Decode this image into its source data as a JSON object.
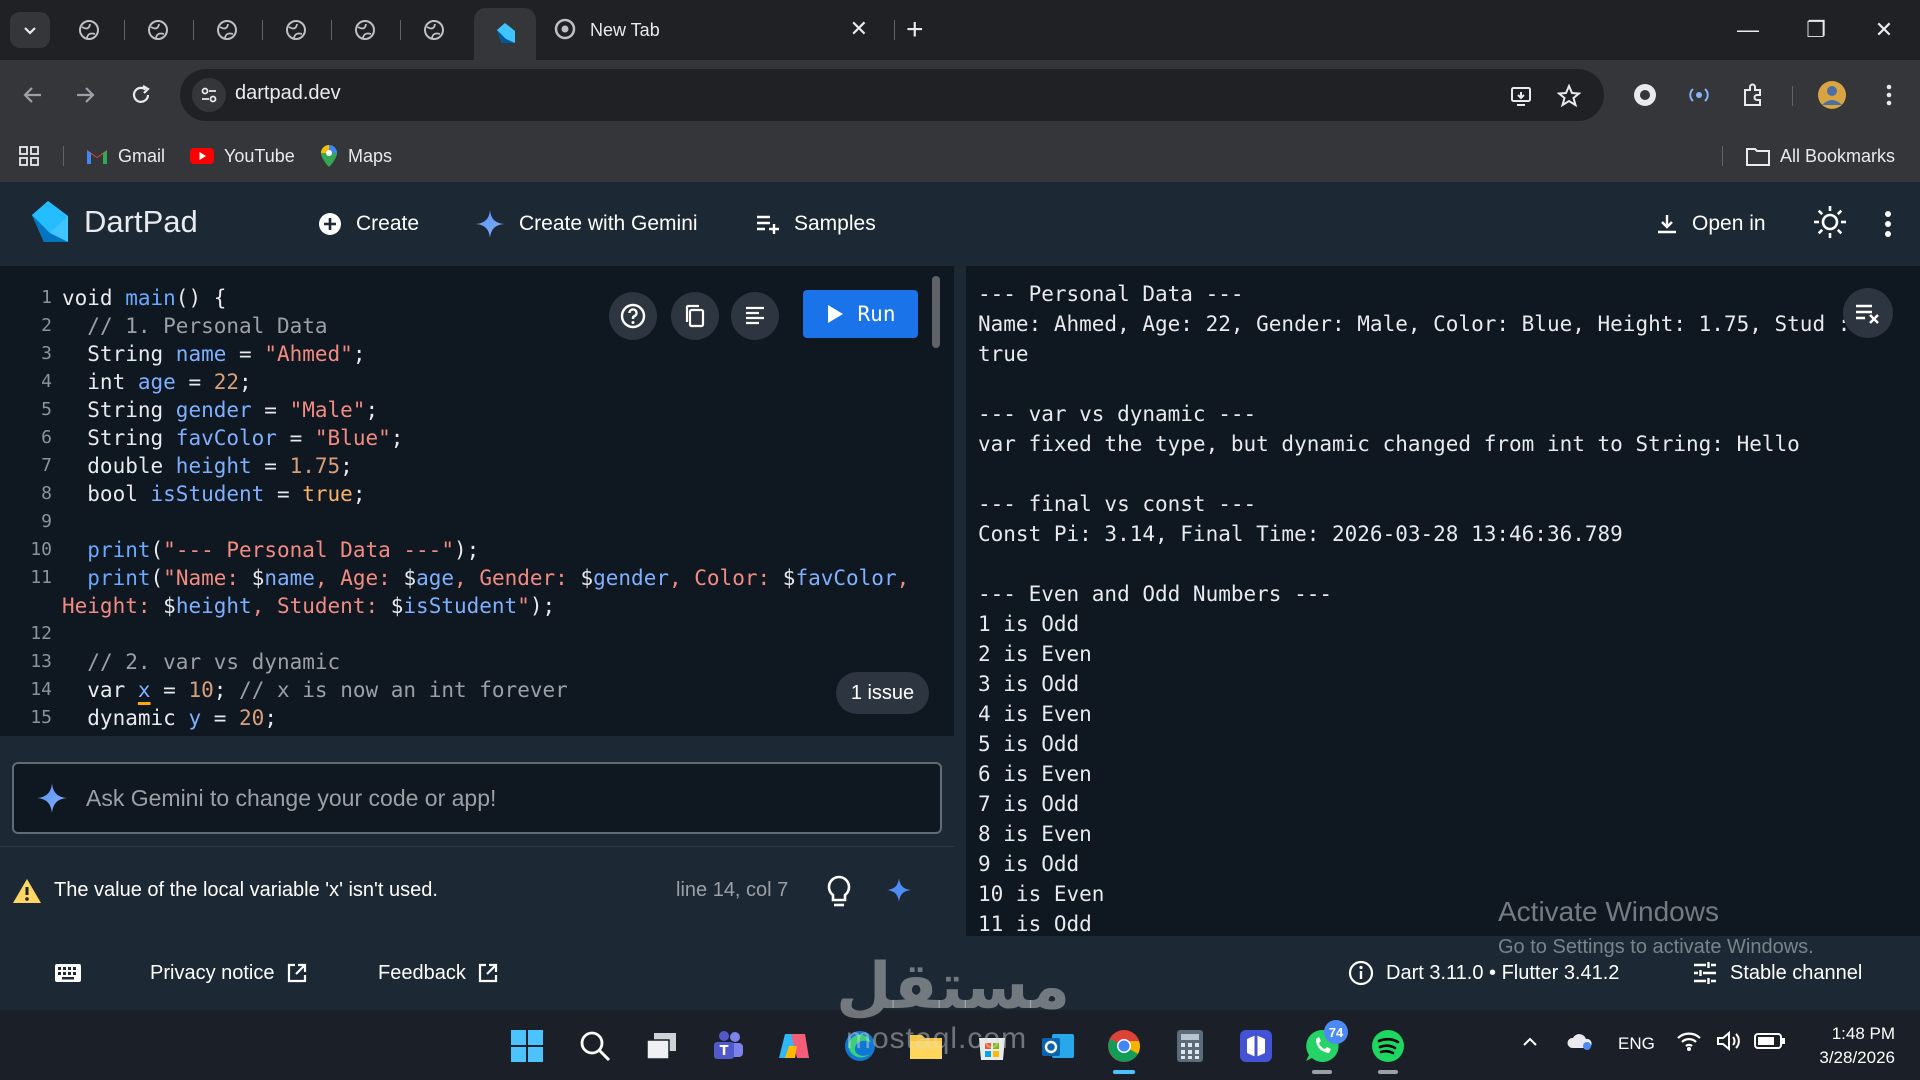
{
  "browser": {
    "new_tab_title": "New Tab",
    "close_glyph": "✕",
    "new_tab_glyph": "+",
    "url": "dartpad.dev",
    "window_controls": {
      "minimize": "—",
      "restore": "❐",
      "close": "✕"
    }
  },
  "bookmarks": {
    "items": [
      {
        "label": "Gmail",
        "icon": "gmail-icon"
      },
      {
        "label": "YouTube",
        "icon": "youtube-icon"
      },
      {
        "label": "Maps",
        "icon": "maps-icon"
      }
    ],
    "all_bookmarks": "All Bookmarks"
  },
  "header": {
    "brand": "DartPad",
    "create": "Create",
    "create_gemini": "Create with Gemini",
    "samples": "Samples",
    "open_in": "Open in"
  },
  "editor": {
    "run_label": "Run",
    "issue_badge": "1 issue",
    "line_numbers": [
      "1",
      "2",
      "3",
      "4",
      "5",
      "6",
      "7",
      "8",
      "9",
      "10",
      "11",
      "",
      "12",
      "13",
      "14",
      "15"
    ]
  },
  "gemini": {
    "placeholder": "Ask Gemini to change your code or app!"
  },
  "problems": {
    "message": "The value of the local variable 'x' isn't used.",
    "position": "line 14, col 7"
  },
  "console": {
    "lines": [
      "--- Personal Data ---",
      "Name: Ahmed, Age: 22, Gender: Male, Color: Blue, Height: 1.75, Stud :",
      "true",
      "",
      "--- var vs dynamic ---",
      "var fixed the type, but dynamic changed from int to String: Hello",
      "",
      "--- final vs const ---",
      "Const Pi: 3.14, Final Time: 2026-03-28 13:46:36.789",
      "",
      "--- Even and Odd Numbers ---",
      "1 is Odd",
      "2 is Even",
      "3 is Odd",
      "4 is Even",
      "5 is Odd",
      "6 is Even",
      "7 is Odd",
      "8 is Even",
      "9 is Odd",
      "10 is Even",
      "11 is Odd"
    ]
  },
  "footer": {
    "privacy": "Privacy notice",
    "feedback": "Feedback",
    "version": "Dart 3.11.0 • Flutter 3.41.2",
    "channel": "Stable channel"
  },
  "watermark": {
    "activate_title": "Activate Windows",
    "activate_sub": "Go to Settings to activate Windows.",
    "mostaql": "مستقل",
    "mostaql_sub": "mostaql.com"
  },
  "taskbar": {
    "lang": "ENG",
    "time": "1:48 PM",
    "date": "3/28/2026",
    "whatsapp_badge": "74"
  },
  "colors": {
    "run_blue": "#1a73e8",
    "header_bg": "#1c2834",
    "editor_bg": "#0f1720"
  }
}
